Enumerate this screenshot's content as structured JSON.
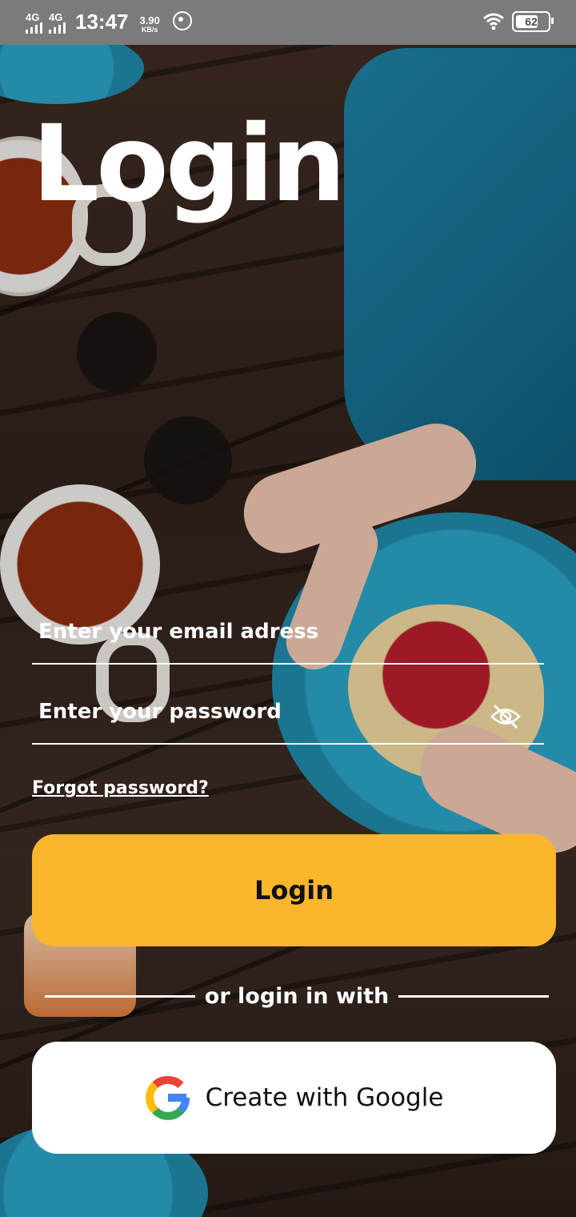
{
  "status_bar": {
    "network1": "4G",
    "network2": "4G",
    "time": "13:47",
    "speed_value": "3.90",
    "speed_unit": "KB/s",
    "battery": "62",
    "icons": [
      "signal-icon",
      "whatsapp-icon",
      "wifi-icon",
      "battery-icon"
    ]
  },
  "page": {
    "title": "Login"
  },
  "form": {
    "email_placeholder": "Enter your email adress",
    "password_placeholder": "Enter your password",
    "forgot_password": "Forgot password?",
    "login_button": "Login",
    "divider_text": "or login in with",
    "google_button": "Create with Google"
  },
  "colors": {
    "accent": "#fcb62e",
    "text_on_bg": "#ffffff",
    "status_bar_bg": "#7b7b7b"
  }
}
